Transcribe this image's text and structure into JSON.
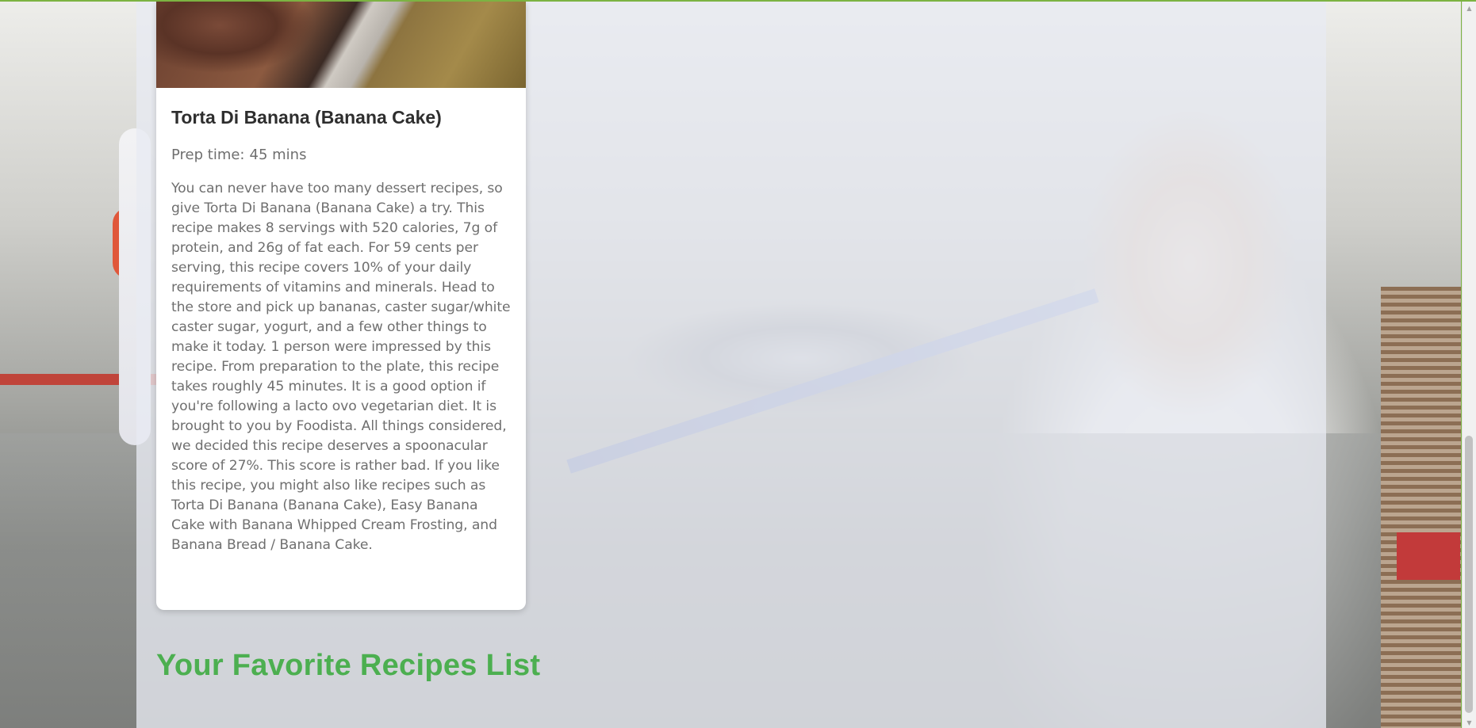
{
  "recipe": {
    "title": "Torta Di Banana (Banana Cake)",
    "prep_label": "Prep time:",
    "prep_value": "45 mins",
    "summary": "You can never have too many dessert recipes, so give Torta Di Banana (Banana Cake) a try. This recipe makes 8 servings with 520 calories, 7g of protein, and 26g of fat each. For 59 cents per serving, this recipe covers 10% of your daily requirements of vitamins and minerals. Head to the store and pick up bananas, caster sugar/white caster sugar, yogurt, and a few other things to make it today. 1 person were impressed by this recipe. From preparation to the plate, this recipe takes roughly 45 minutes. It is a good option if you're following a lacto ovo vegetarian diet. It is brought to you by Foodista. All things considered, we decided this recipe deserves a spoonacular score of 27%. This score is rather bad. If you like this recipe, you might also like recipes such as Torta Di Banana (Banana Cake), Easy Banana Cake with Banana Whipped Cream Frosting, and Banana Bread / Banana Cake."
  },
  "favorites": {
    "heading": "Your Favorite Recipes List"
  },
  "scrollbar": {
    "up_icon": "▲",
    "down_icon": "▼"
  },
  "colors": {
    "accent_green": "#4caf50",
    "panel": "#e8eaf2",
    "card": "#ffffff"
  }
}
